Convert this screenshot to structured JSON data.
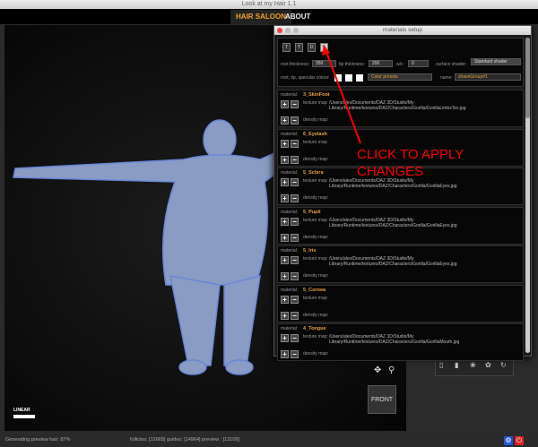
{
  "app": {
    "title": "Look at my Hair 1.1",
    "tabs": [
      {
        "label": "HAIR SALOON",
        "active": true
      },
      {
        "label": "ABOUT",
        "active": false
      }
    ]
  },
  "viewport": {
    "nav_icons": [
      "move-icon",
      "zoom-icon"
    ],
    "view_cube": "FRONT",
    "interp_label": "LINEAR"
  },
  "materials_window": {
    "title": "materials setup",
    "toolbar_icons": [
      "import-texture-icon",
      "import-texture-icon-2",
      "import-density-icon",
      "apply-changes-icon"
    ],
    "root_thickness_label": "root thickness:",
    "root_thickness": "350",
    "tip_thickness_label": "tip thickness:",
    "tip_thickness": "200",
    "wc_label": "w/c:",
    "wc": "0",
    "surface_shader_label": "surface shader:",
    "surface_shader": "Standard shader",
    "colors_label": "root, tip, specular colors:",
    "color_presets": "Color presets",
    "name_label": "name:",
    "name": "shaveGroup#1",
    "material_label": "material:",
    "texture_label": "texture map:",
    "density_label": "density map:",
    "materials": [
      {
        "name": "3_SkinFoot",
        "texture": "/Users/alex/Documents/DAZ 3D/Studio/My Library/Runtime/textures/DAZ/Characters/Gorilla/GorillaLimbsTex.jpg"
      },
      {
        "name": "6_Eyelash",
        "texture": ""
      },
      {
        "name": "5_Sclera",
        "texture": "/Users/alex/Documents/DAZ 3D/Studio/My Library/Runtime/textures/DAZ/Characters/Gorilla/GorillaEyes.jpg"
      },
      {
        "name": "5_Pupil",
        "texture": "/Users/alex/Documents/DAZ 3D/Studio/My Library/Runtime/textures/DAZ/Characters/Gorilla/GorillaEyes.jpg"
      },
      {
        "name": "5_Iris",
        "texture": "/Users/alex/Documents/DAZ 3D/Studio/My Library/Runtime/textures/DAZ/Characters/Gorilla/GorillaEyes.jpg"
      },
      {
        "name": "5_Cornea",
        "texture": ""
      },
      {
        "name": "4_Tongue",
        "texture": "/Users/alex/Documents/DAZ 3D/Studio/My Library/Runtime/textures/DAZ/Characters/Gorilla/GorillaMouth.jpg"
      }
    ]
  },
  "annotation": {
    "text": "CLICK TO APPLY CHANGES",
    "color": "#ff0000"
  },
  "right_panel": {
    "icons": [
      "delete-icon",
      "trash-icon",
      "paw-icon",
      "paw-outline-icon",
      "refresh-icon"
    ]
  },
  "status": {
    "left": "Generating preview hair: 87%",
    "center": "follicles: [12665] guides: [14964]  preview : [13109]"
  },
  "corner_buttons": [
    {
      "icon": "gear-icon",
      "color": "#2255dd"
    },
    {
      "icon": "power-icon",
      "color": "#dd2222"
    }
  ]
}
